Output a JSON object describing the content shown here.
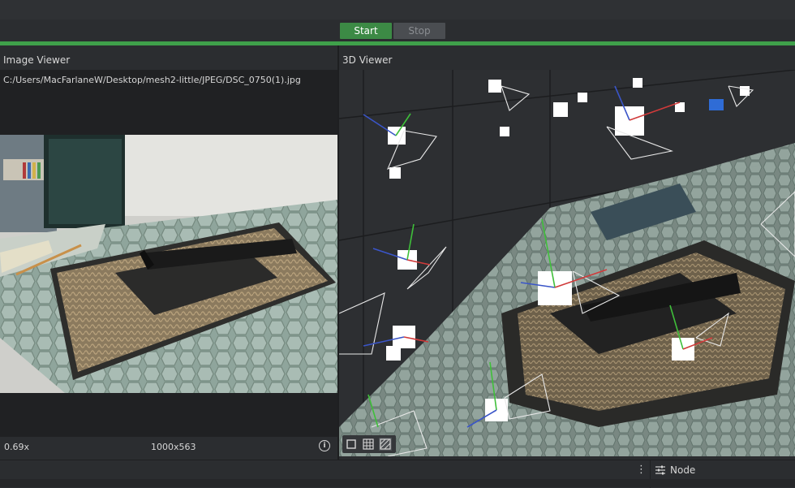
{
  "toolbar": {
    "start_label": "Start",
    "stop_label": "Stop"
  },
  "progress": {
    "value": 1.0
  },
  "image_viewer": {
    "title": "Image Viewer",
    "file_path": "C:/Users/MacFarlaneW/Desktop/mesh2-little/JPEG/DSC_0750(1).jpg",
    "zoom": "0.69x",
    "dimensions": "1000x563",
    "info_icon": "info-icon"
  },
  "viewer_3d": {
    "title": "3D Viewer",
    "tools": [
      "solid-view-icon",
      "wireframe-grid-icon",
      "textured-view-icon"
    ]
  },
  "statusbar": {
    "menu_icon": "kebab-menu-icon",
    "node_icon": "sliders-icon",
    "node_label": "Node"
  },
  "colors": {
    "accent": "#3fa04a",
    "start_button": "#3c8a45",
    "panel_bg": "#2b2d30"
  }
}
